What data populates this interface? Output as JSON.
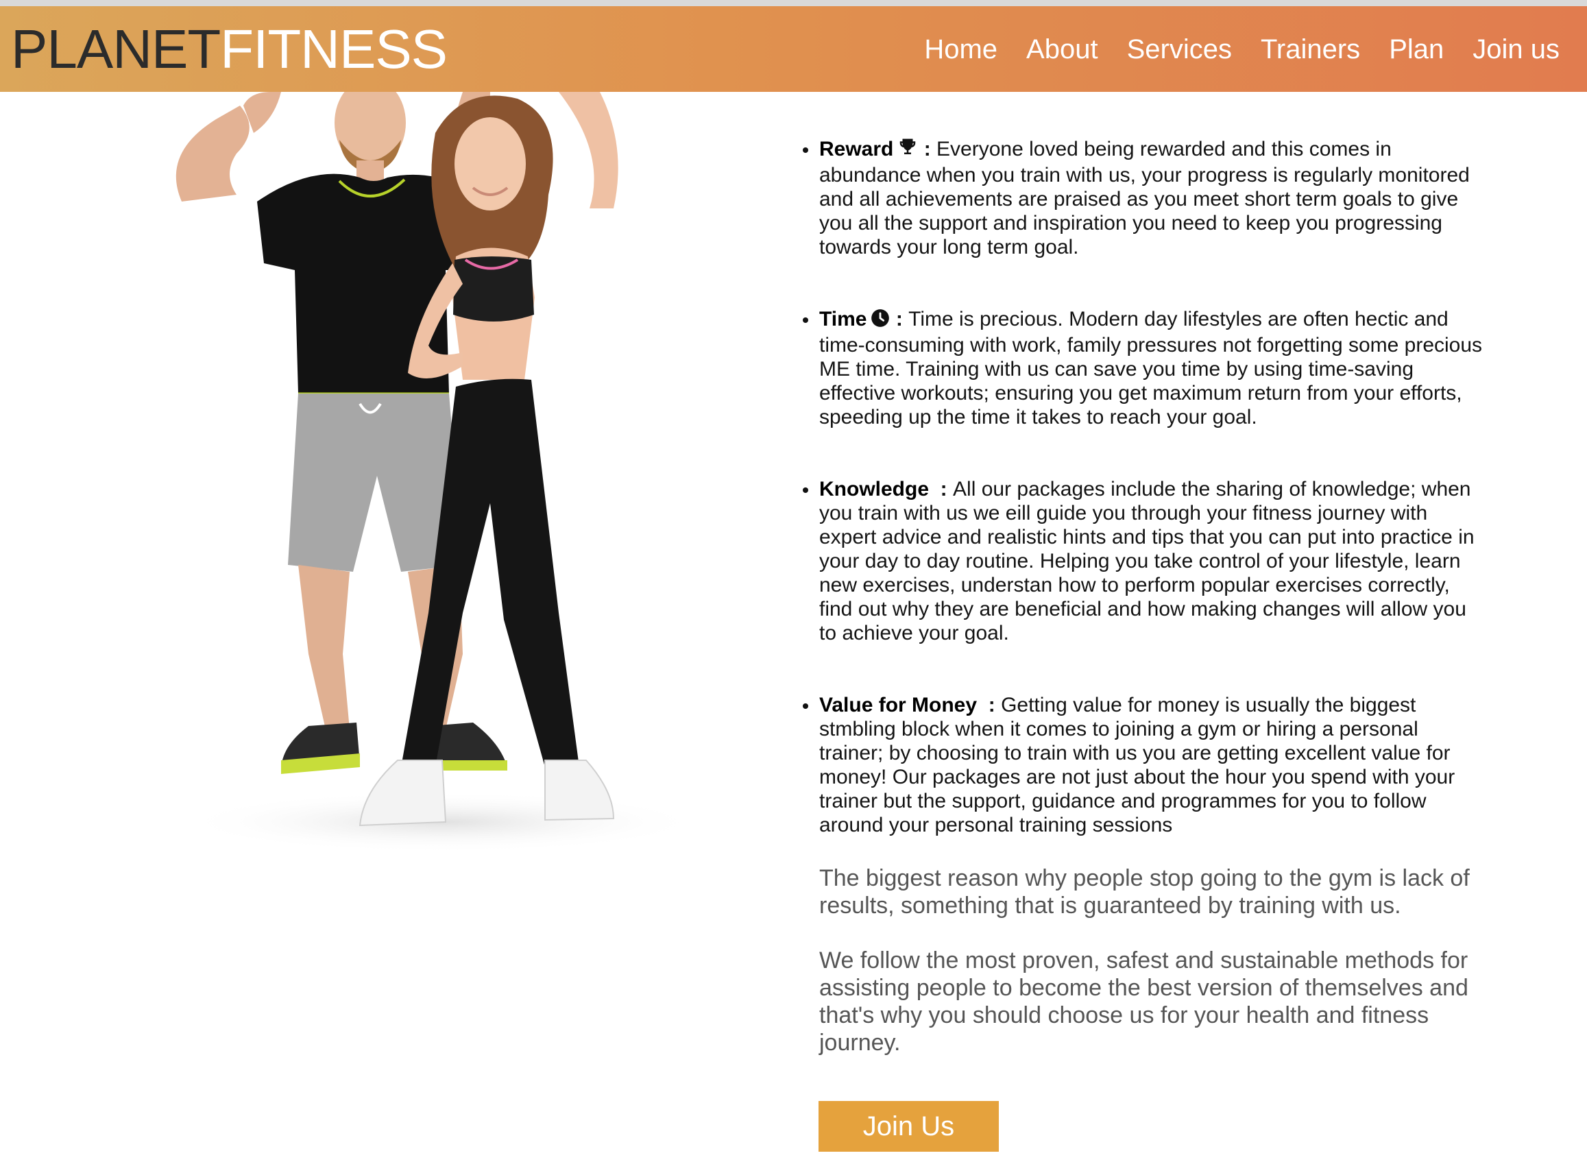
{
  "brand": {
    "part1": "PLANET",
    "part2": "FITNESS"
  },
  "nav": [
    "Home",
    "About",
    "Services",
    "Trainers",
    "Plan",
    "Join us"
  ],
  "benefits": [
    {
      "title": "Reward",
      "icon": "trophy-icon",
      "text": "Everyone loved being rewarded and this comes in abundance when you train with us, your progress is regularly monitored and all achievements are praised as you meet short term goals to give you all the support and inspiration you need to keep you progressing towards your long term goal."
    },
    {
      "title": "Time",
      "icon": "clock-icon",
      "text": "Time is precious. Modern day lifestyles are often hectic and time-consuming with work, family pressures not forgetting some precious ME time. Training with us can save you time by using time-saving effective workouts; ensuring you get maximum return from your efforts, speeding up the time it takes to reach your goal."
    },
    {
      "title": "Knowledge",
      "icon": "",
      "text": "All our packages include the sharing of knowledge; when you train with us we eill guide you through your fitness journey with expert advice and realistic hints and tips that you can put into practice in your day to day routine. Helping you take control of your lifestyle, learn new exercises, understan how to perform popular exercises correctly, find out why they are beneficial and how making changes will allow you to achieve your goal."
    },
    {
      "title": "Value for Money",
      "icon": "",
      "text": "Getting value for money is usually the biggest stmbling block when it comes to joining a gym or hiring a personal trainer; by choosing to train with us you are getting excellent value for money! Our packages are not just about the hour you spend with your trainer but the support, guidance and programmes for you to follow around your personal training sessions"
    }
  ],
  "closing": [
    "The biggest reason why people stop going to the gym is lack of results, something that is guaranteed by training with us.",
    "We follow the most proven, safest and sustainable methods for assisting people to become the best version of themselves and that's why you should choose us for your health and fitness journey."
  ],
  "cta": {
    "label": "Join Us"
  },
  "colors": {
    "header_start": "#dba65a",
    "header_end": "#e17c4f",
    "button": "#e5a23d"
  }
}
